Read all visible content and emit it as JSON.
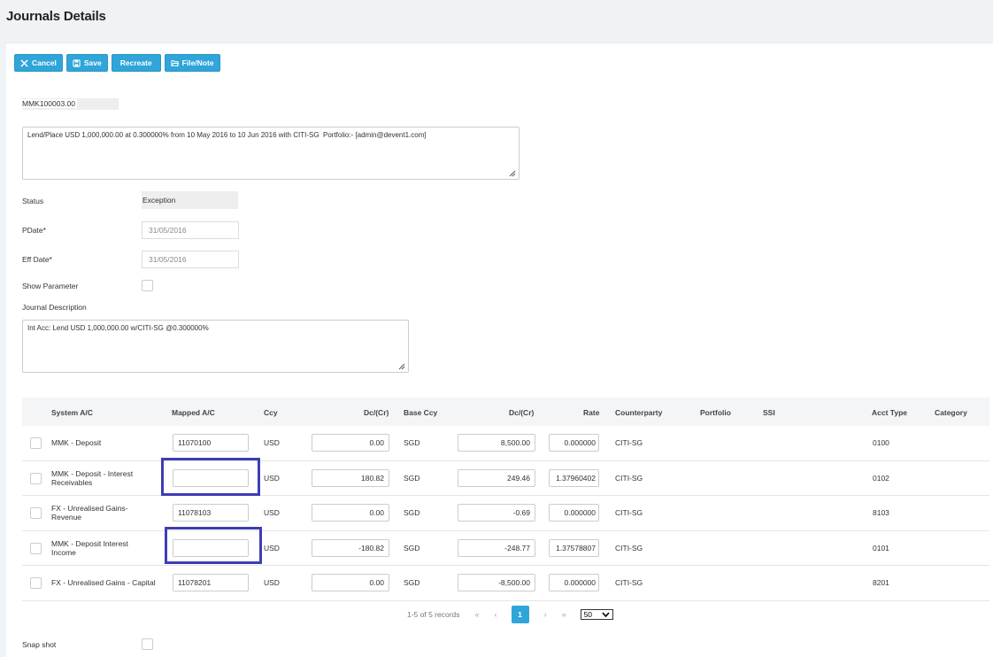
{
  "page": {
    "title": "Journals Details"
  },
  "toolbar": {
    "cancel": "Cancel",
    "save": "Save",
    "recreate": "Recreate",
    "file_note": "File/Note"
  },
  "reference": "MMK100003.00",
  "summary": "Lend/Place USD 1,000,000.00 at 0.300000% from 10 May 2016 to 10 Jun 2016 with CITI-SG  Portfolio:- [admin@devent1.com]",
  "form": {
    "status_label": "Status",
    "status_value": "Exception",
    "pdate_label": "PDate*",
    "pdate_value": "31/05/2016",
    "effdate_label": "Eff Date*",
    "effdate_value": "31/05/2016",
    "show_param_label": "Show Parameter",
    "journal_desc_label": "Journal Description",
    "journal_desc_value": "Int Acc: Lend USD 1,000,000.00 w/CITI-SG @0.300000%",
    "snapshot_label": "Snap shot"
  },
  "grid": {
    "columns": [
      "System A/C",
      "Mapped A/C",
      "Ccy",
      "Dc/(Cr)",
      "Base Ccy",
      "Dc/(Cr)",
      "Rate",
      "Counterparty",
      "Portfolio",
      "SSI",
      "Acct Type",
      "Category"
    ],
    "rows": [
      {
        "system": "MMK - Deposit",
        "mapped": "11070100",
        "ccy": "USD",
        "dc": "0.00",
        "base_ccy": "SGD",
        "base_dc": "8,500.00",
        "rate": "0.000000",
        "counterparty": "CITI-SG",
        "acct_type": "0100"
      },
      {
        "system": "MMK - Deposit - Interest Receivables",
        "mapped": "",
        "ccy": "USD",
        "dc": "180.82",
        "base_ccy": "SGD",
        "base_dc": "249.46",
        "rate": "1.37960402",
        "counterparty": "CITI-SG",
        "acct_type": "0102"
      },
      {
        "system": "FX - Unrealised Gains-Revenue",
        "mapped": "11078103",
        "ccy": "USD",
        "dc": "0.00",
        "base_ccy": "SGD",
        "base_dc": "-0.69",
        "rate": "0.000000",
        "counterparty": "CITI-SG",
        "acct_type": "8103"
      },
      {
        "system": "MMK - Deposit Interest Income",
        "mapped": "",
        "ccy": "USD",
        "dc": "-180.82",
        "base_ccy": "SGD",
        "base_dc": "-248.77",
        "rate": "1.37578807",
        "counterparty": "CITI-SG",
        "acct_type": "0101"
      },
      {
        "system": "FX - Unrealised Gains - Capital",
        "mapped": "11078201",
        "ccy": "USD",
        "dc": "0.00",
        "base_ccy": "SGD",
        "base_dc": "-8,500.00",
        "rate": "0.000000",
        "counterparty": "CITI-SG",
        "acct_type": "8201"
      }
    ]
  },
  "pager": {
    "records": "1-5 of 5 records",
    "first": "«",
    "prev": "‹",
    "current": "1",
    "next": "›",
    "last": "»",
    "page_size": "50"
  },
  "colors": {
    "accent": "#30a5d9",
    "highlight": "#3d3eb3"
  }
}
